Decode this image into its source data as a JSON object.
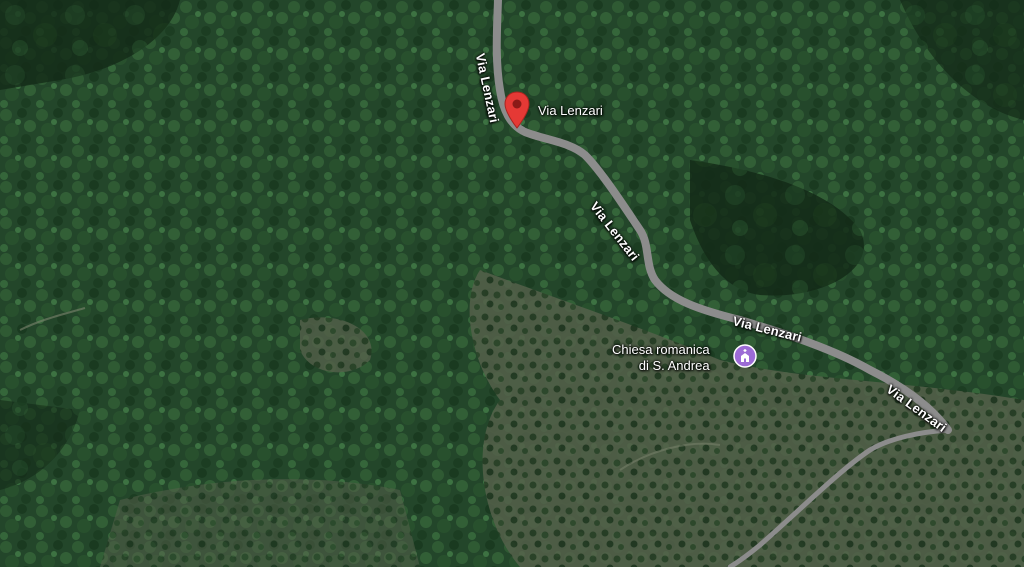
{
  "map": {
    "type": "satellite",
    "pin": {
      "icon": "red-location-pin-icon",
      "color": "#e53935",
      "label": "Via Lenzari"
    },
    "roads": [
      {
        "name": "Via Lenzari"
      },
      {
        "name": "Via Lenzari"
      },
      {
        "name": "Via Lenzari"
      },
      {
        "name": "Via Lenzari"
      }
    ],
    "poi": {
      "icon": "church-icon",
      "color": "#9c6bd6",
      "line1": "Chiesa romanica",
      "line2": "di S. Andrea"
    }
  }
}
